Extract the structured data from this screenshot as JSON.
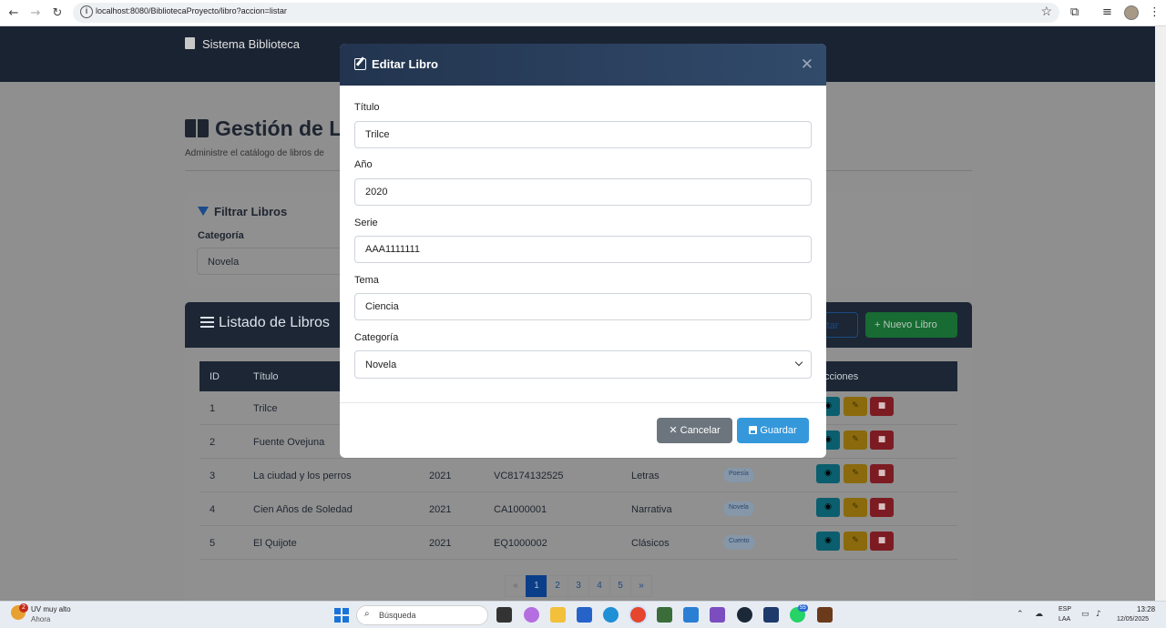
{
  "browser": {
    "url": "localhost:8080/BibliotecaProyecto/libro?accion=listar"
  },
  "app": {
    "brand": "Sistema Biblioteca",
    "page_title": "Gestión de Li",
    "subtitle": "Administre el catálogo de libros de",
    "filter": {
      "title": "Filtrar Libros",
      "category_label": "Categoría",
      "category_value": "Novela"
    },
    "list": {
      "title": "Listado de Libros",
      "export_label": "rtar",
      "new_label": "+ Nuevo Libro",
      "columns": [
        "ID",
        "Título",
        "cciones"
      ],
      "rows": [
        {
          "id": "1",
          "title": "Trilce",
          "year": "",
          "serie": "",
          "tema": "",
          "cat": ""
        },
        {
          "id": "2",
          "title": "Fuente Ovejuna",
          "year": "",
          "serie": "",
          "tema": "",
          "cat": ""
        },
        {
          "id": "3",
          "title": "La ciudad y los perros",
          "year": "2021",
          "serie": "VC8174132525",
          "tema": "Letras",
          "cat": "Poesía"
        },
        {
          "id": "4",
          "title": "Cien Años de Soledad",
          "year": "2021",
          "serie": "CA1000001",
          "tema": "Narrativa",
          "cat": "Novela"
        },
        {
          "id": "5",
          "title": "El Quijote",
          "year": "2021",
          "serie": "EQ1000002",
          "tema": "Clásicos",
          "cat": "Cuento"
        }
      ],
      "pagination": [
        "«",
        "1",
        "2",
        "3",
        "4",
        "5",
        "»"
      ]
    }
  },
  "modal": {
    "title": "Editar Libro",
    "fields": {
      "titulo": {
        "label": "Título",
        "value": "Trilce"
      },
      "anio": {
        "label": "Año",
        "value": "2020"
      },
      "serie": {
        "label": "Serie",
        "value": "AAA1111111"
      },
      "tema": {
        "label": "Tema",
        "value": "Ciencia"
      },
      "categoria": {
        "label": "Categoría",
        "value": "Novela"
      }
    },
    "cancel_label": "Cancelar",
    "save_label": "Guardar"
  },
  "taskbar": {
    "weather_text": "UV muy alto",
    "weather_sub": "Ahora",
    "weather_badge": "2",
    "search_placeholder": "Búsqueda",
    "whatsapp_badge": "55",
    "lang1": "ESP",
    "lang2": "LAA",
    "time": "13:28",
    "date": "12/05/2025"
  }
}
